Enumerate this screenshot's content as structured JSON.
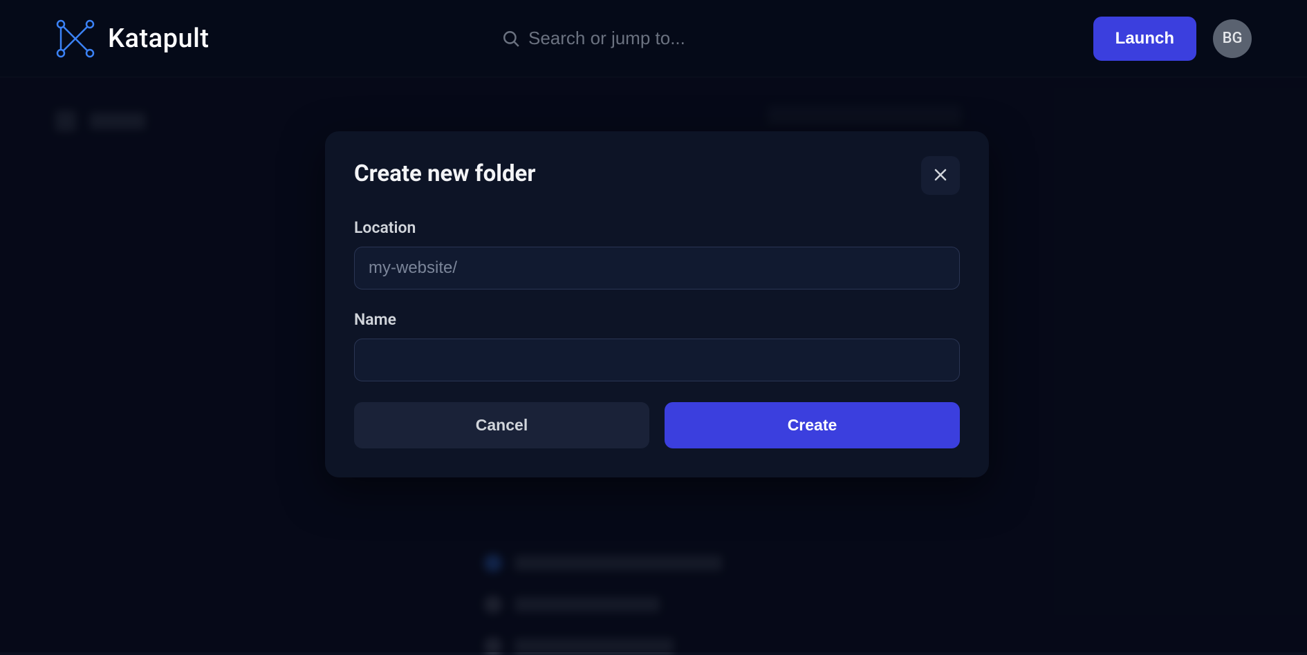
{
  "header": {
    "brand": "Katapult",
    "search_placeholder": "Search or jump to...",
    "launch_label": "Launch",
    "avatar_initials": "BG"
  },
  "modal": {
    "title": "Create new folder",
    "location_label": "Location",
    "location_value": "my-website/",
    "name_label": "Name",
    "name_value": "",
    "cancel_label": "Cancel",
    "create_label": "Create"
  }
}
